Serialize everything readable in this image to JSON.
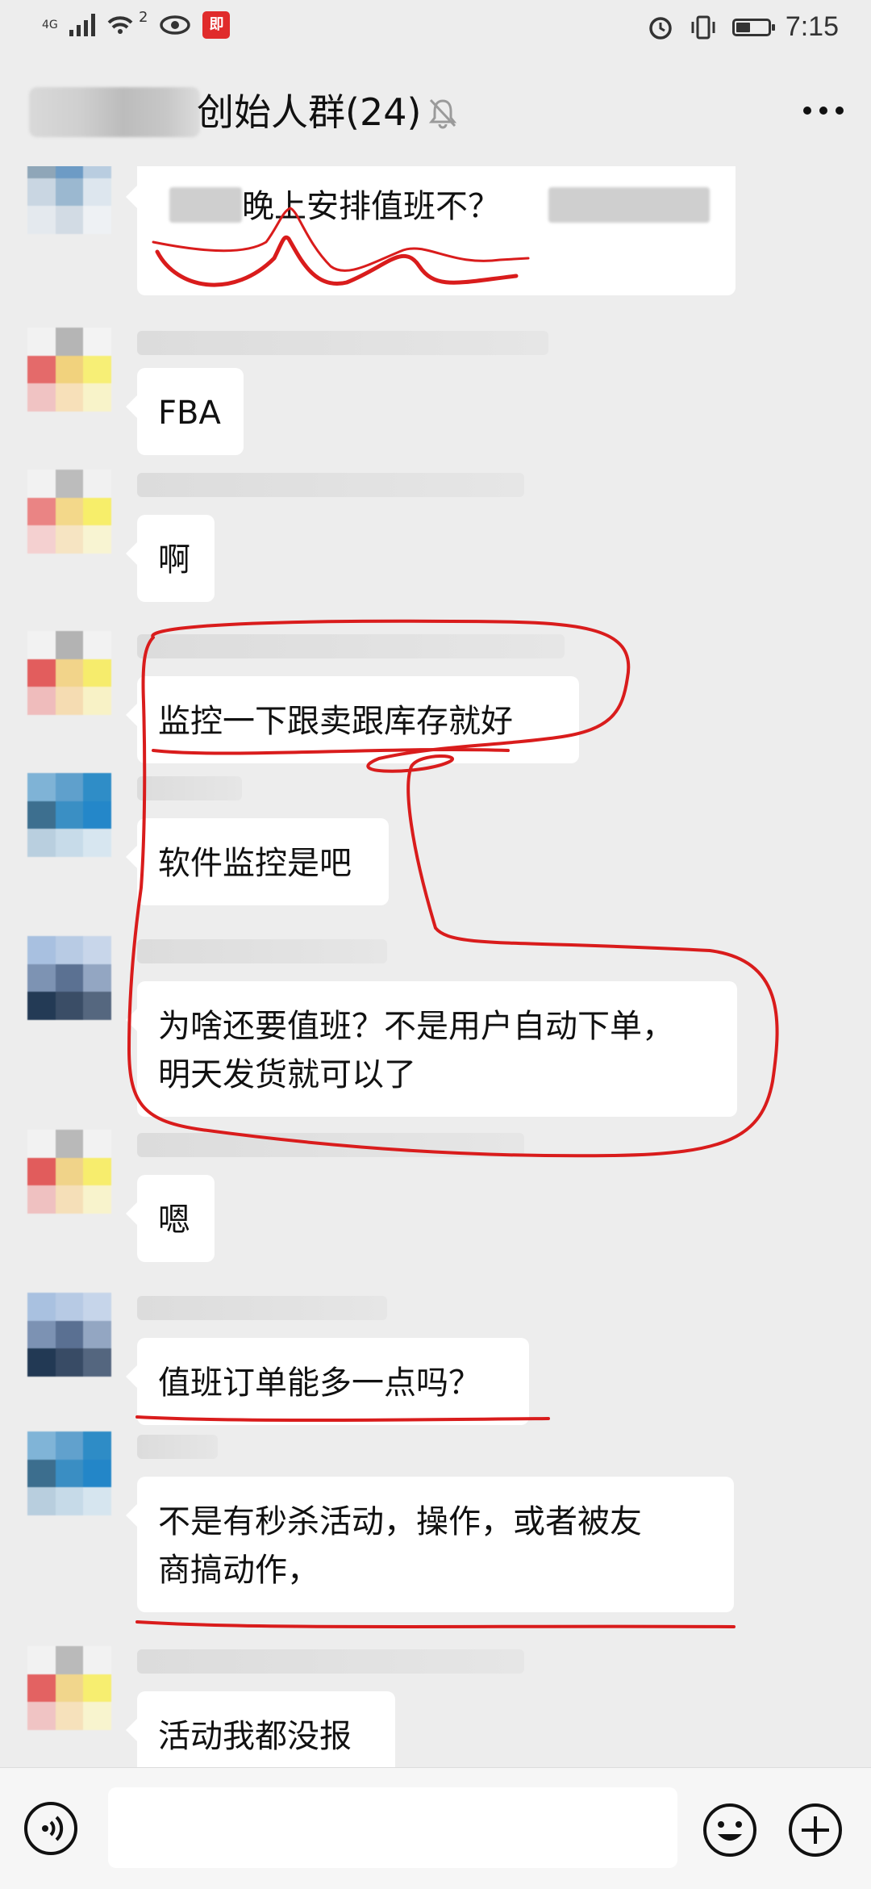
{
  "status_bar": {
    "network": "4G",
    "wifi_badge": "2",
    "app_badge": "即",
    "battery_level": 0.45,
    "time": "7:15"
  },
  "header": {
    "title": "创始人群(24)",
    "muted_icon": "bell-off-icon",
    "more_icon": "more-icon"
  },
  "messages": [
    {
      "text": "晚上安排值班不？"
    },
    {
      "text": "FBA"
    },
    {
      "text": "啊"
    },
    {
      "text": "监控一下跟卖跟库存就好"
    },
    {
      "text": "软件监控是吧"
    },
    {
      "lines": [
        "为啥还要值班？不是用户自动下单，",
        "明天发货就可以了"
      ]
    },
    {
      "text": "嗯"
    },
    {
      "text": "值班订单能多一点吗？"
    },
    {
      "lines": [
        "不是有秒杀活动，操作，或者被友",
        "商搞动作，"
      ]
    },
    {
      "text": "活动我都没报"
    }
  ],
  "input_bar": {
    "voice_icon": "voice-icon",
    "placeholder": "",
    "emoji_icon": "emoji-icon",
    "plus_icon": "plus-icon"
  },
  "colors": {
    "background": "#ededed",
    "bubble": "#ffffff",
    "annotation": "#d91c1c"
  }
}
